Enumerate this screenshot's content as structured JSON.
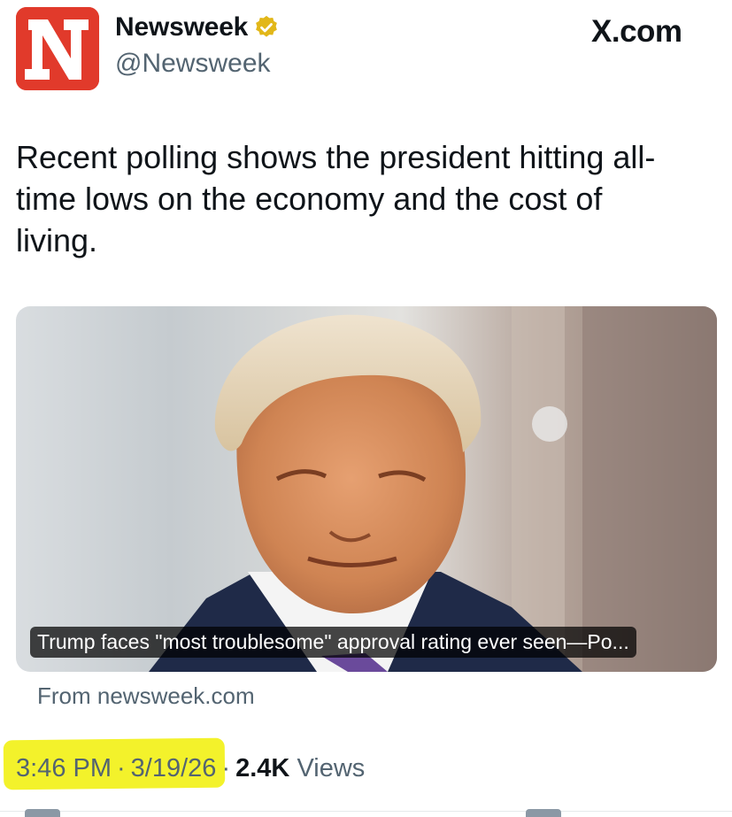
{
  "account": {
    "display_name": "Newsweek",
    "handle": "@Newsweek",
    "logo_letter": "N",
    "verified_icon": "verified-gold-badge-icon",
    "logo_color": "#e13a2b"
  },
  "brand": {
    "label": "X.com"
  },
  "tweet": {
    "text": "Recent polling shows the president hitting all-time lows on the economy and the cost of living."
  },
  "card": {
    "title": "Trump faces \"most troublesome\" approval rating ever seen—Po...",
    "source": "From newsweek.com"
  },
  "meta": {
    "time": "3:46 PM",
    "separator": "·",
    "date": "3/19/26",
    "views_count": "2.4K",
    "views_label": "Views",
    "highlight_color": "#f3f22b"
  }
}
